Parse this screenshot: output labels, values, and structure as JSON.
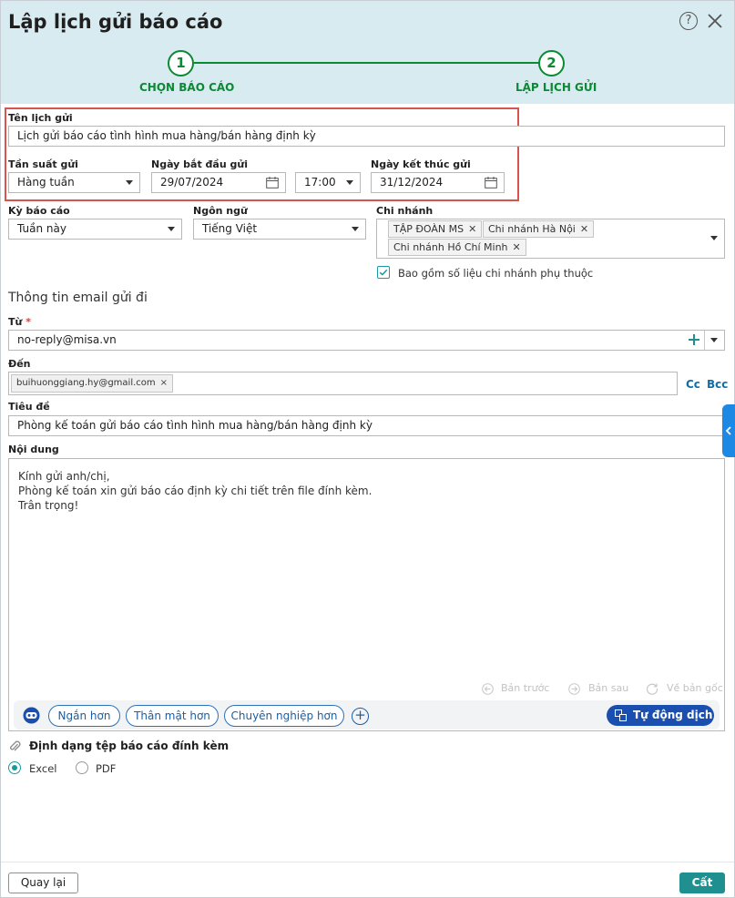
{
  "dialog": {
    "title": "Lập lịch gửi báo cáo",
    "help_icon": "question-circle-icon",
    "help_glyph": "?",
    "close_icon": "close-icon"
  },
  "steps": [
    {
      "number": "1",
      "label": "CHỌN BÁO CÁO"
    },
    {
      "number": "2",
      "label": "LẬP LỊCH GỬI"
    }
  ],
  "schedule": {
    "name_label": "Tên lịch gửi",
    "name_value": "Lịch gửi báo cáo tình hình mua hàng/bán hàng định kỳ",
    "frequency_label": "Tần suất gửi",
    "frequency_value": "Hàng tuần",
    "start_label": "Ngày bắt đầu gửi",
    "start_date": "29/07/2024",
    "start_time": "17:00",
    "end_label": "Ngày kết thúc gửi",
    "end_date": "31/12/2024"
  },
  "report": {
    "period_label": "Kỳ báo cáo",
    "period_value": "Tuần này",
    "language_label": "Ngôn ngữ",
    "language_value": "Tiếng Việt",
    "branch_label": "Chi nhánh",
    "branches": [
      "TẬP ĐOÀN MS",
      "Chi nhánh Hà Nội",
      "Chi nhánh Hồ Chí Minh"
    ],
    "remove_glyph": "✕",
    "include_sub_label": "Bao gồm số liệu chi nhánh phụ thuộc",
    "include_sub_checked": true
  },
  "email": {
    "section_title": "Thông tin email gửi đi",
    "from_label": "Từ",
    "required_mark": "*",
    "from_value": "no-reply@misa.vn",
    "to_label": "Đến",
    "to_recipients": [
      "buihuonggiang.hy@gmail.com"
    ],
    "to_remove_glyph": "×",
    "cc_label": "Cc",
    "bcc_label": "Bcc",
    "subject_label": "Tiêu đề",
    "subject_value": "Phòng kế toán gửi báo cáo tình hình mua hàng/bán hàng định kỳ",
    "content_label": "Nội dung",
    "content_lines": [
      "Kính gửi anh/chị,",
      "Phòng kế toán xin gửi báo cáo định kỳ chi tiết trên file đính kèm.",
      "Trân trọng!"
    ]
  },
  "editor": {
    "prev_version": "Bản trước",
    "next_version": "Bản sau",
    "original_version": "Về bản gốc",
    "chips": [
      "Ngắn hơn",
      "Thân mật hơn",
      "Chuyên nghiệp hơn"
    ],
    "add_glyph": "+",
    "translate_label": "Tự động dịch"
  },
  "attachment": {
    "title": "Định dạng tệp báo cáo đính kèm",
    "options": [
      "Excel",
      "PDF"
    ],
    "selected": "Excel"
  },
  "footer": {
    "back_label": "Quay lại",
    "save_label": "Cất"
  },
  "colors": {
    "header_bg": "#d8ebf0",
    "step_green": "#0a8a32",
    "highlight_red": "#d9534f",
    "accent_teal": "#1f8f8f",
    "translate_blue": "#1a4fb0"
  }
}
